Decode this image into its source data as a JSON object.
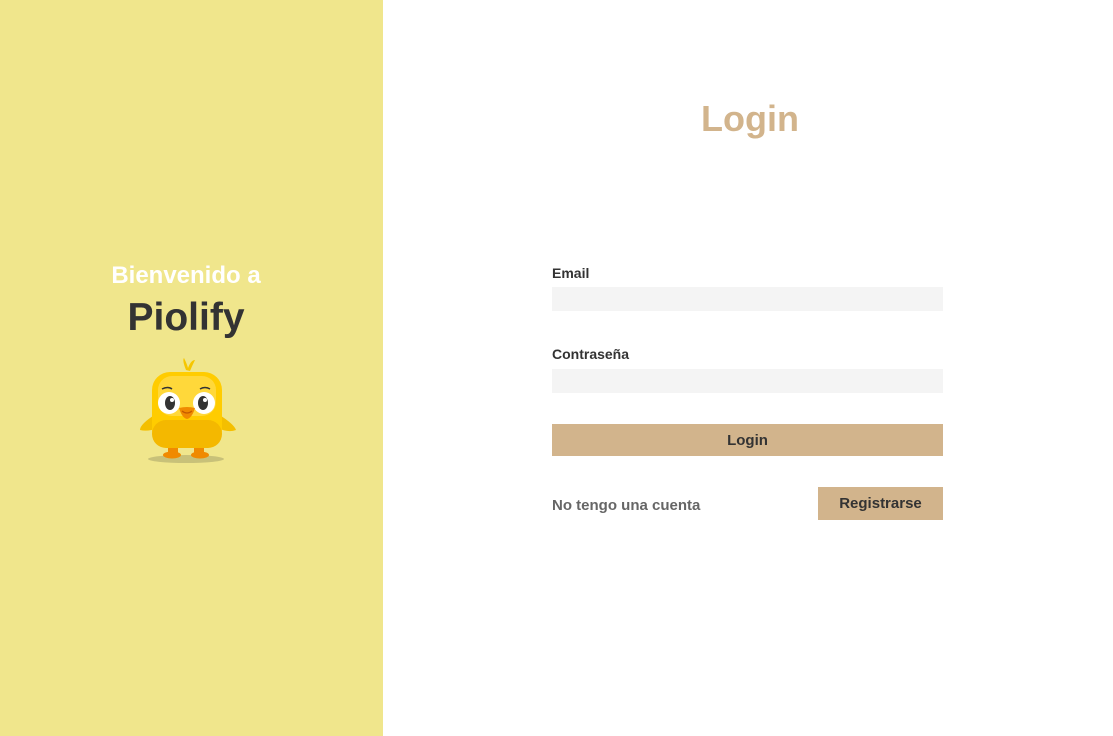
{
  "sidebar": {
    "welcome_text": "Bienvenido a",
    "brand_name": "Piolify",
    "mascot_icon": "yellow-chick-icon",
    "background_color": "#f0e68c"
  },
  "login": {
    "title": "Login",
    "title_color": "#d2b48c",
    "email_label": "Email",
    "email_value": "",
    "password_label": "Contraseña",
    "password_value": "",
    "login_button_label": "Login",
    "no_account_text": "No tengo una cuenta",
    "register_button_label": "Registrarse",
    "accent_color": "#d2b48c",
    "input_background": "#f4f4f4"
  }
}
